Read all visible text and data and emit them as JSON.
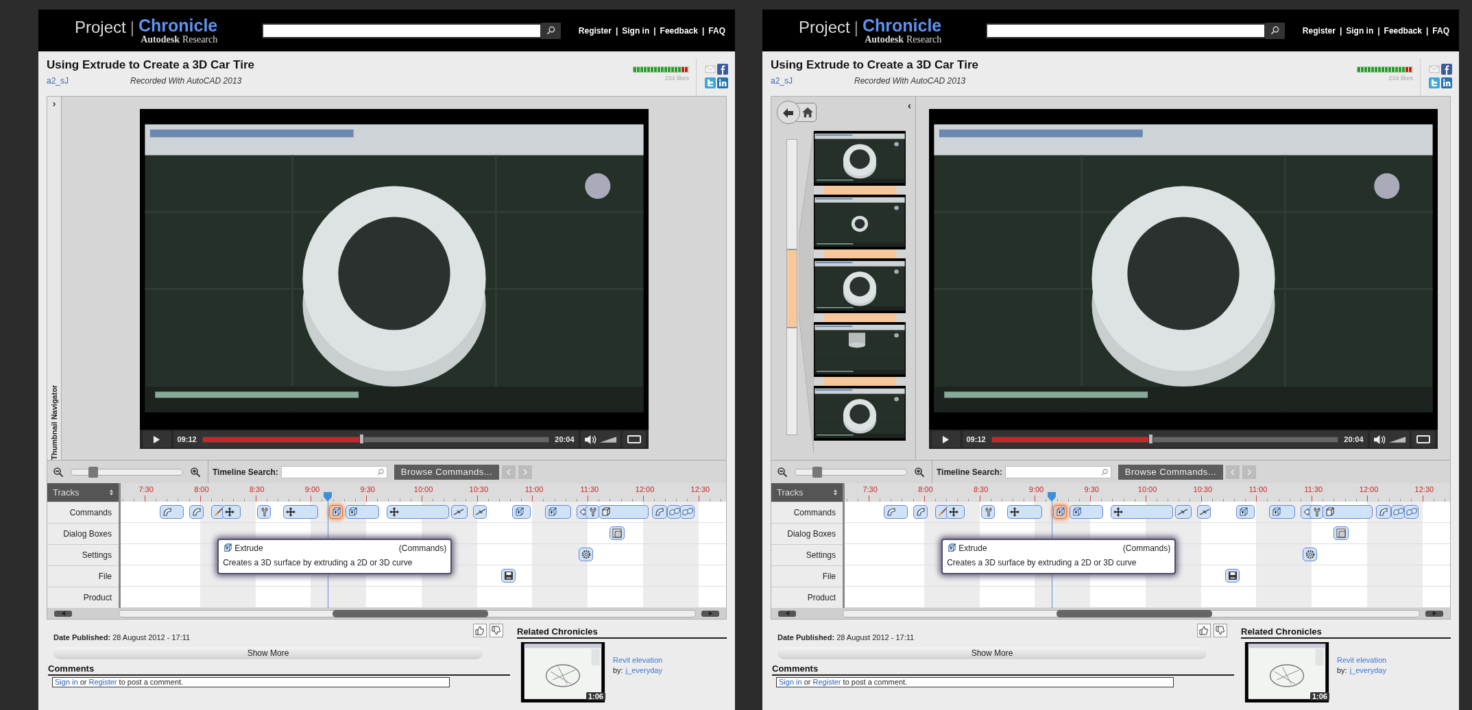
{
  "panels": [
    {
      "header": {
        "logo": {
          "project": "Project",
          "separator": "|",
          "product": "Chronicle",
          "company": "Autodesk",
          "division": "Research"
        },
        "links": [
          "Register",
          "Sign in",
          "Feedback",
          "FAQ"
        ],
        "link_separator": "|"
      },
      "title_bar": {
        "title": "Using Extrude to Create a 3D Car Tire",
        "author": "a2_sJ",
        "recorded": "Recorded With AutoCAD 2013",
        "rating": {
          "level": 0.875
        },
        "likes": "234 likes"
      },
      "navigator": {
        "expanded": false,
        "toggle": "›",
        "label": "Thumbnail Navigator"
      },
      "video": {
        "current": "09:12",
        "duration": "20:04",
        "level": 0.459
      },
      "toolbar": {
        "zoom": {
          "level": 0.2
        },
        "search_label": "Timeline Search:",
        "browse": "Browse Commands..."
      },
      "timeline": {
        "tracks_label": "Tracks",
        "ticks": [
          "7:30",
          "8:00",
          "8:30",
          "9:00",
          "9:30",
          "10:00",
          "10:30",
          "11:00",
          "11:30",
          "12:00",
          "12:30"
        ],
        "tracks": [
          {
            "name": "Commands",
            "events": [
              {
                "kind": "arc",
                "selected": false
              },
              {
                "kind": "arc",
                "selected": false
              },
              {
                "kind": "paint",
                "selected": false
              },
              {
                "kind": "move",
                "selected": false
              },
              {
                "kind": "wrench",
                "selected": false
              },
              {
                "kind": "move",
                "selected": false
              },
              {
                "kind": "extrude",
                "selected": true
              },
              {
                "kind": "extrude",
                "selected": false
              },
              {
                "kind": "move",
                "selected": false
              },
              {
                "kind": "line",
                "selected": false
              },
              {
                "kind": "line",
                "selected": false
              },
              {
                "kind": "extrude",
                "selected": false
              },
              {
                "kind": "extrude",
                "selected": false
              },
              {
                "kind": "arrow",
                "selected": false
              },
              {
                "kind": "wrench",
                "selected": false
              },
              {
                "kind": "box",
                "selected": false
              },
              {
                "kind": "arc",
                "selected": false
              },
              {
                "kind": "cubes",
                "selected": false
              },
              {
                "kind": "cubes",
                "selected": false
              }
            ]
          },
          {
            "name": "Dialog Boxes",
            "events": [
              {
                "kind": "dialog",
                "selected": false
              }
            ]
          },
          {
            "name": "Settings",
            "events": [
              {
                "kind": "gear",
                "selected": false
              }
            ]
          },
          {
            "name": "File",
            "events": [
              {
                "kind": "save",
                "selected": false
              }
            ]
          },
          {
            "name": "Product"
          }
        ],
        "tooltip": {
          "kind": "extrude",
          "title": "Extrude",
          "category": "(Commands)",
          "description": "Creates a 3D surface by extruding a 2D or 3D curve"
        }
      },
      "details": {
        "date_label": "Date Published:",
        "date": "28 August 2012 - 17:11",
        "show_more": "Show More",
        "comments_heading": "Comments",
        "comment_prompt": {
          "sign_in": "Sign in",
          "or": "or",
          "register": "Register",
          "rest": "to post a comment."
        }
      },
      "related": {
        "heading": "Related Chronicles",
        "items": [
          {
            "kind": "picture",
            "duration": "1:06",
            "title": "Revit elevation",
            "by": "by:",
            "author": "j_everyday"
          }
        ]
      }
    },
    {
      "header": {
        "logo": {
          "project": "Project",
          "separator": "|",
          "product": "Chronicle",
          "company": "Autodesk",
          "division": "Research"
        },
        "links": [
          "Register",
          "Sign in",
          "Feedback",
          "FAQ"
        ],
        "link_separator": "|"
      },
      "title_bar": {
        "title": "Using Extrude to Create a 3D Car Tire",
        "author": "a2_sJ",
        "recorded": "Recorded With AutoCAD 2013",
        "rating": {
          "level": 0.875
        },
        "likes": "234 likes"
      },
      "navigator": {
        "expanded": true,
        "toggle": "‹"
      },
      "video": {
        "current": "09:12",
        "duration": "20:04",
        "level": 0.459
      },
      "toolbar": {
        "zoom": {
          "level": 0.2
        },
        "search_label": "Timeline Search:",
        "browse": "Browse Commands..."
      },
      "timeline": {
        "tracks_label": "Tracks",
        "ticks": [
          "7:30",
          "8:00",
          "8:30",
          "9:00",
          "9:30",
          "10:00",
          "10:30",
          "11:00",
          "11:30",
          "12:00",
          "12:30"
        ],
        "tracks": [
          {
            "name": "Commands",
            "events": [
              {
                "kind": "arc",
                "selected": false
              },
              {
                "kind": "arc",
                "selected": false
              },
              {
                "kind": "paint",
                "selected": false
              },
              {
                "kind": "move",
                "selected": false
              },
              {
                "kind": "wrench",
                "selected": false
              },
              {
                "kind": "move",
                "selected": false
              },
              {
                "kind": "extrude",
                "selected": true
              },
              {
                "kind": "extrude",
                "selected": false
              },
              {
                "kind": "move",
                "selected": false
              },
              {
                "kind": "line",
                "selected": false
              },
              {
                "kind": "line",
                "selected": false
              },
              {
                "kind": "extrude",
                "selected": false
              },
              {
                "kind": "extrude",
                "selected": false
              },
              {
                "kind": "arrow",
                "selected": false
              },
              {
                "kind": "wrench",
                "selected": false
              },
              {
                "kind": "box",
                "selected": false
              },
              {
                "kind": "arc",
                "selected": false
              },
              {
                "kind": "cubes",
                "selected": false
              },
              {
                "kind": "cubes",
                "selected": false
              }
            ]
          },
          {
            "name": "Dialog Boxes",
            "events": [
              {
                "kind": "dialog",
                "selected": false
              }
            ]
          },
          {
            "name": "Settings",
            "events": [
              {
                "kind": "gear",
                "selected": false
              }
            ]
          },
          {
            "name": "File",
            "events": [
              {
                "kind": "save",
                "selected": false
              }
            ]
          },
          {
            "name": "Product"
          }
        ],
        "tooltip": {
          "kind": "extrude",
          "title": "Extrude",
          "category": "(Commands)",
          "description": "Creates a 3D surface by extruding a 2D or 3D curve"
        }
      },
      "details": {
        "date_label": "Date Published:",
        "date": "28 August 2012 - 17:11",
        "show_more": "Show More",
        "comments_heading": "Comments",
        "comment_prompt": {
          "sign_in": "Sign in",
          "or": "or",
          "register": "Register",
          "rest": "to post a comment."
        }
      },
      "related": {
        "heading": "Related Chronicles",
        "items": [
          {
            "kind": "picture",
            "duration": "1:06",
            "title": "Revit elevation",
            "by": "by:",
            "author": "j_everyday"
          }
        ]
      }
    }
  ]
}
